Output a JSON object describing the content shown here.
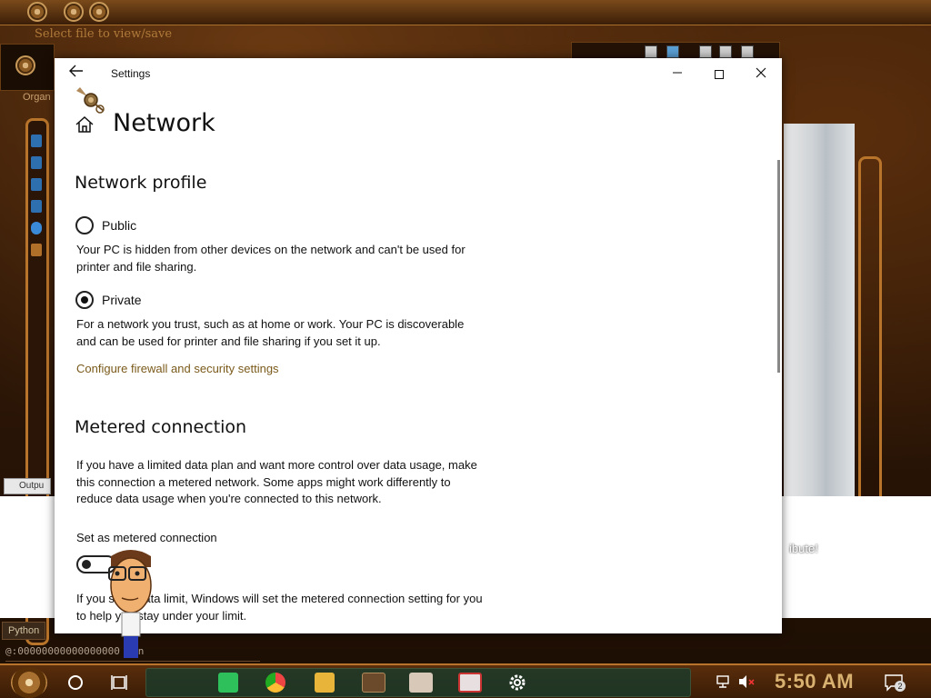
{
  "background": {
    "app_title": "Select file to view/save",
    "organize_label": "Organ",
    "output_tab": "Outpu",
    "python_tab": "Python",
    "console_text": "@:00000000000000000 own",
    "attribution": "ibute!"
  },
  "settings_window": {
    "title": "Settings",
    "page_title": "Network",
    "network_profile": {
      "heading": "Network profile",
      "public_label": "Public",
      "public_desc": "Your PC is hidden from other devices on the network and can't be used for printer and file sharing.",
      "private_label": "Private",
      "private_desc": "For a network you trust, such as at home or work. Your PC is discoverable and can be used for printer and file sharing if you set it up.",
      "selected": "Private",
      "firewall_link": "Configure firewall and security settings"
    },
    "metered_connection": {
      "heading": "Metered connection",
      "desc": "If you have a limited data plan and want more control over data usage, make this connection a metered network. Some apps might work differently to reduce data usage when you're connected to this network.",
      "toggle_label": "Set as metered connection",
      "toggle_state": "Off",
      "footer_desc": "If you set a data limit, Windows will set the metered connection setting for you to help you stay under your limit."
    }
  },
  "taskbar": {
    "clock": "5:50 AM",
    "notification_count": "2",
    "pinned_icons": [
      "notes-icon",
      "chrome-icon",
      "folder-icon",
      "media-icon",
      "portrait-icon",
      "acrobat-icon",
      "gear-icon"
    ]
  },
  "colors": {
    "link": "#7a5a1a",
    "clock": "#d8b070",
    "theme_bronze": "#b8742a"
  }
}
